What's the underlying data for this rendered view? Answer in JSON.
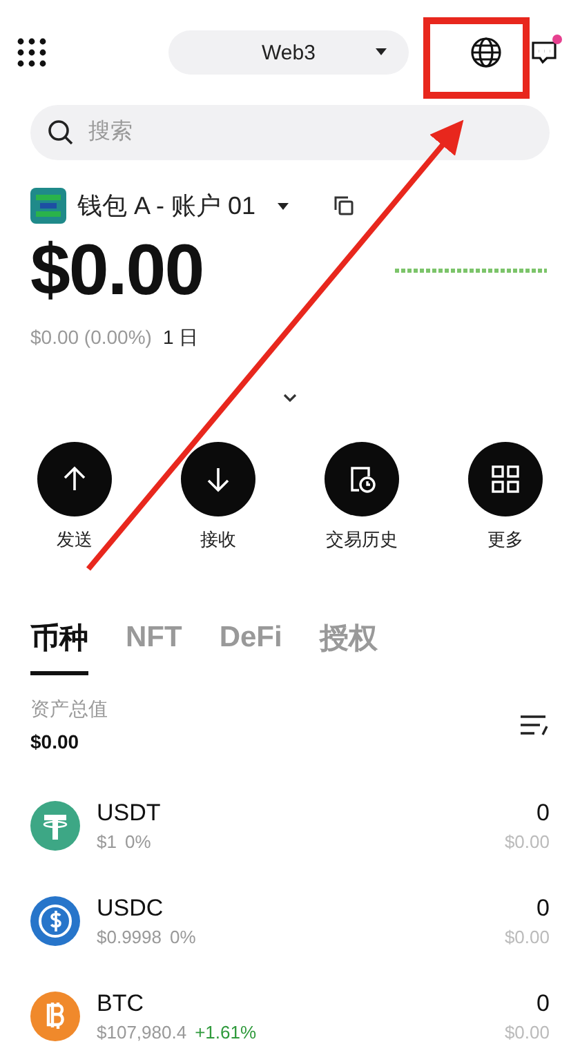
{
  "header": {
    "network": "Web3"
  },
  "search": {
    "placeholder": "搜索"
  },
  "account": {
    "name": "钱包 A - 账户 01"
  },
  "balance": {
    "amount": "$0.00",
    "change": "$0.00 (0.00%)",
    "period": "1 日"
  },
  "actions": [
    {
      "kind": "send",
      "label": "发送"
    },
    {
      "kind": "receive",
      "label": "接收"
    },
    {
      "kind": "history",
      "label": "交易历史"
    },
    {
      "kind": "more",
      "label": "更多"
    }
  ],
  "tabs": [
    {
      "label": "币种",
      "selected": true
    },
    {
      "label": "NFT",
      "selected": false
    },
    {
      "label": "DeFi",
      "selected": false
    },
    {
      "label": "授权",
      "selected": false
    }
  ],
  "total": {
    "label": "资产总值",
    "value": "$0.00"
  },
  "coins": [
    {
      "kind": "usdt",
      "symbol": "USDT",
      "price": "$1",
      "change": "0%",
      "color": "#999999",
      "amount": "0",
      "value": "$0.00"
    },
    {
      "kind": "usdc",
      "symbol": "USDC",
      "price": "$0.9998",
      "change": "0%",
      "color": "#999999",
      "amount": "0",
      "value": "$0.00"
    },
    {
      "kind": "btc",
      "symbol": "BTC",
      "price": "$107,980.4",
      "change": "+1.61%",
      "color": "#2f9a3c",
      "amount": "0",
      "value": "$0.00"
    }
  ]
}
